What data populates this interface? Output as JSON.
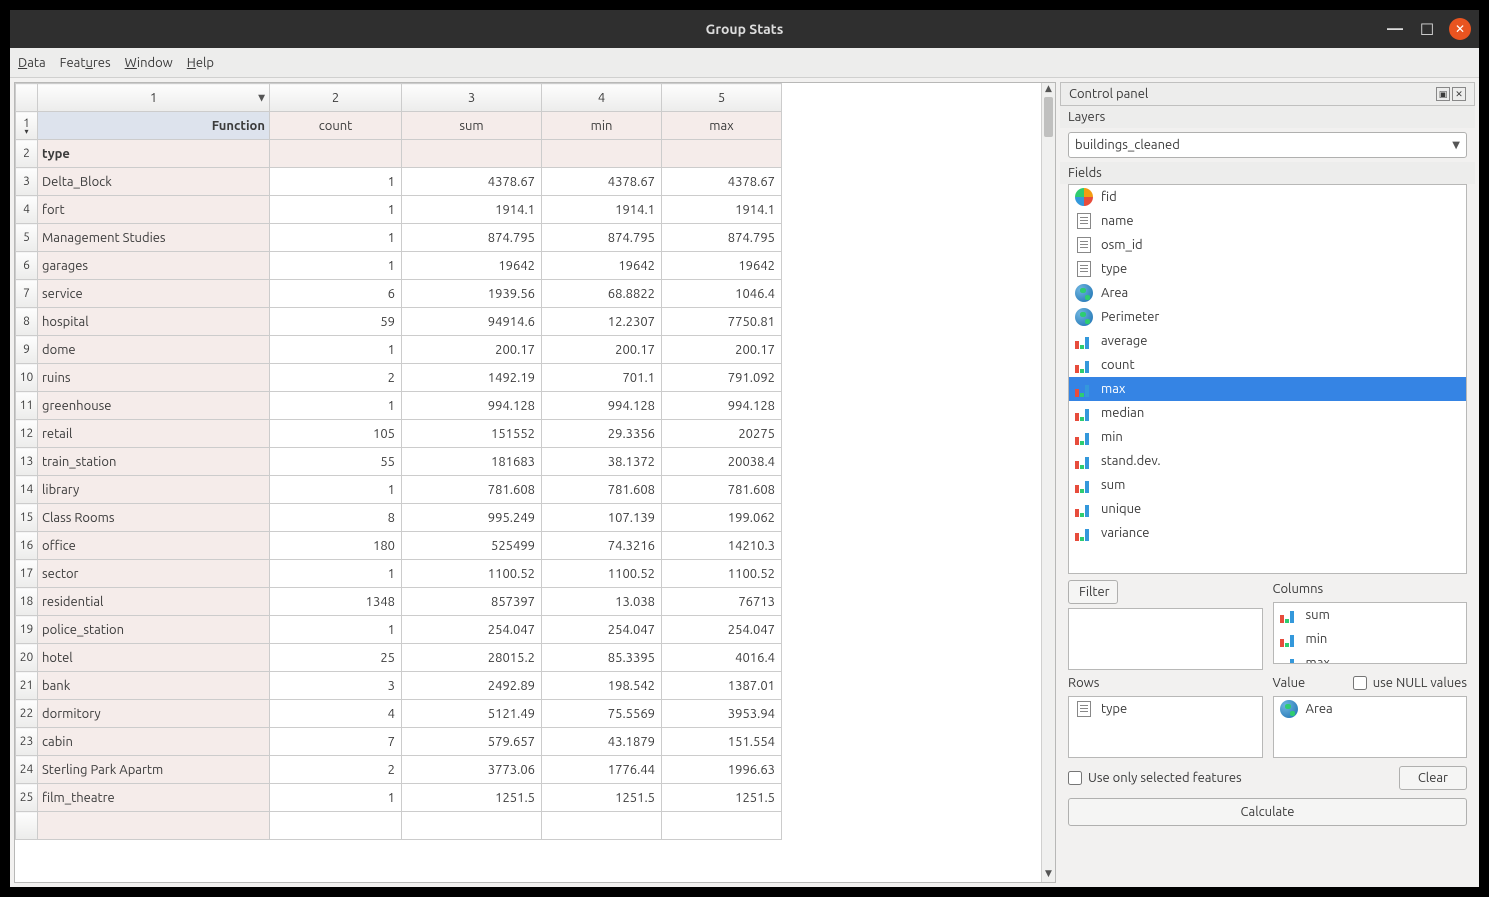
{
  "window": {
    "title": "Group Stats"
  },
  "menubar": [
    "Data",
    "Features",
    "Window",
    "Help"
  ],
  "table": {
    "col_numbers": [
      "1",
      "2",
      "3",
      "4",
      "5"
    ],
    "function_label": "Function",
    "type_label": "type",
    "func_headers": [
      "count",
      "sum",
      "min",
      "max"
    ],
    "rows": [
      {
        "n": "3",
        "label": "Delta_Block",
        "count": "1",
        "sum": "4378.67",
        "min": "4378.67",
        "max": "4378.67"
      },
      {
        "n": "4",
        "label": "fort",
        "count": "1",
        "sum": "1914.1",
        "min": "1914.1",
        "max": "1914.1"
      },
      {
        "n": "5",
        "label": "Management Studies",
        "count": "1",
        "sum": "874.795",
        "min": "874.795",
        "max": "874.795"
      },
      {
        "n": "6",
        "label": "garages",
        "count": "1",
        "sum": "19642",
        "min": "19642",
        "max": "19642"
      },
      {
        "n": "7",
        "label": "service",
        "count": "6",
        "sum": "1939.56",
        "min": "68.8822",
        "max": "1046.4"
      },
      {
        "n": "8",
        "label": "hospital",
        "count": "59",
        "sum": "94914.6",
        "min": "12.2307",
        "max": "7750.81"
      },
      {
        "n": "9",
        "label": "dome",
        "count": "1",
        "sum": "200.17",
        "min": "200.17",
        "max": "200.17"
      },
      {
        "n": "10",
        "label": "ruins",
        "count": "2",
        "sum": "1492.19",
        "min": "701.1",
        "max": "791.092"
      },
      {
        "n": "11",
        "label": "greenhouse",
        "count": "1",
        "sum": "994.128",
        "min": "994.128",
        "max": "994.128"
      },
      {
        "n": "12",
        "label": "retail",
        "count": "105",
        "sum": "151552",
        "min": "29.3356",
        "max": "20275"
      },
      {
        "n": "13",
        "label": "train_station",
        "count": "55",
        "sum": "181683",
        "min": "38.1372",
        "max": "20038.4"
      },
      {
        "n": "14",
        "label": "library",
        "count": "1",
        "sum": "781.608",
        "min": "781.608",
        "max": "781.608"
      },
      {
        "n": "15",
        "label": "Class Rooms",
        "count": "8",
        "sum": "995.249",
        "min": "107.139",
        "max": "199.062"
      },
      {
        "n": "16",
        "label": "office",
        "count": "180",
        "sum": "525499",
        "min": "74.3216",
        "max": "14210.3"
      },
      {
        "n": "17",
        "label": "sector",
        "count": "1",
        "sum": "1100.52",
        "min": "1100.52",
        "max": "1100.52"
      },
      {
        "n": "18",
        "label": "residential",
        "count": "1348",
        "sum": "857397",
        "min": "13.038",
        "max": "76713"
      },
      {
        "n": "19",
        "label": "police_station",
        "count": "1",
        "sum": "254.047",
        "min": "254.047",
        "max": "254.047"
      },
      {
        "n": "20",
        "label": "hotel",
        "count": "25",
        "sum": "28015.2",
        "min": "85.3395",
        "max": "4016.4"
      },
      {
        "n": "21",
        "label": "bank",
        "count": "3",
        "sum": "2492.89",
        "min": "198.542",
        "max": "1387.01"
      },
      {
        "n": "22",
        "label": "dormitory",
        "count": "4",
        "sum": "5121.49",
        "min": "75.5569",
        "max": "3953.94"
      },
      {
        "n": "23",
        "label": "cabin",
        "count": "7",
        "sum": "579.657",
        "min": "43.1879",
        "max": "151.554"
      },
      {
        "n": "24",
        "label": "Sterling Park Apartm",
        "count": "2",
        "sum": "3773.06",
        "min": "1776.44",
        "max": "1996.63"
      },
      {
        "n": "25",
        "label": "film_theatre",
        "count": "1",
        "sum": "1251.5",
        "min": "1251.5",
        "max": "1251.5"
      }
    ]
  },
  "control_panel": {
    "title": "Control panel",
    "layers_label": "Layers",
    "layer_selected": "buildings_cleaned",
    "fields_label": "Fields",
    "fields": [
      {
        "icon": "pie",
        "name": "fid"
      },
      {
        "icon": "doc",
        "name": "name"
      },
      {
        "icon": "doc",
        "name": "osm_id"
      },
      {
        "icon": "doc",
        "name": "type"
      },
      {
        "icon": "globe",
        "name": "Area"
      },
      {
        "icon": "globe",
        "name": "Perimeter"
      },
      {
        "icon": "bars",
        "name": "average"
      },
      {
        "icon": "bars",
        "name": "count"
      },
      {
        "icon": "bars",
        "name": "max",
        "selected": true
      },
      {
        "icon": "bars",
        "name": "median"
      },
      {
        "icon": "bars",
        "name": "min"
      },
      {
        "icon": "bars",
        "name": "stand.dev."
      },
      {
        "icon": "bars",
        "name": "sum"
      },
      {
        "icon": "bars",
        "name": "unique"
      },
      {
        "icon": "bars",
        "name": "variance"
      }
    ],
    "filter_label": "Filter",
    "columns_label": "Columns",
    "columns_items": [
      {
        "icon": "bars",
        "name": "sum"
      },
      {
        "icon": "bars",
        "name": "min"
      },
      {
        "icon": "bars",
        "name": "max"
      }
    ],
    "rows_label": "Rows",
    "rows_items": [
      {
        "icon": "doc",
        "name": "type"
      }
    ],
    "value_label": "Value",
    "null_label": "use NULL values",
    "value_items": [
      {
        "icon": "globe",
        "name": "Area"
      }
    ],
    "use_selected_label": "Use only selected features",
    "clear_label": "Clear",
    "calculate_label": "Calculate"
  }
}
